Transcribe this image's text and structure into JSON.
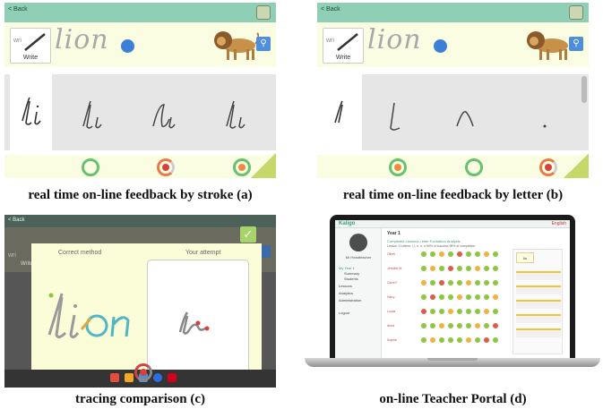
{
  "panel_a": {
    "back": "< Back",
    "write_prefix": "wri",
    "write_label": "Write",
    "word": "lion",
    "caption": "real time on-line feedback by stroke (a)"
  },
  "panel_b": {
    "back": "< Back",
    "write_prefix": "wri",
    "write_label": "Write",
    "word": "lion",
    "caption": "real time on-line feedback by letter (b)"
  },
  "panel_c": {
    "back": "< Back",
    "write_prefix": "wri",
    "write_label": "Write",
    "correct_method": "Correct method",
    "your_attempt": "Your attempt",
    "caption": "tracing comparison (c)"
  },
  "panel_d": {
    "brand": "Kaligo",
    "language": "English",
    "teacher": "Mr Headteacher",
    "menu": [
      "My Year 1",
      "Summary",
      "Students",
      "Lessons",
      "Analytics",
      "Administration",
      "Logout"
    ],
    "class_title": "Year 1",
    "tabs": "Completed Lessons     Letter Formation Analysis",
    "stats": "Lesson 1    Letters: l, i, o, n, n    96% of success    98% of completion",
    "rows": [
      "Oliver",
      "Jennifer M.",
      "Carol F.",
      "Harry",
      "Lucas",
      "Anna",
      "Sophie"
    ],
    "detail_head": "lio",
    "caption": "on-line Teacher Portal (d)"
  },
  "colors": {
    "app_green": "#8ecfb5",
    "cream": "#fbfde2",
    "success": "#66c26e",
    "warning": "#e87a4a",
    "error": "#d9413d",
    "accent_blue": "#4d8fdc"
  }
}
